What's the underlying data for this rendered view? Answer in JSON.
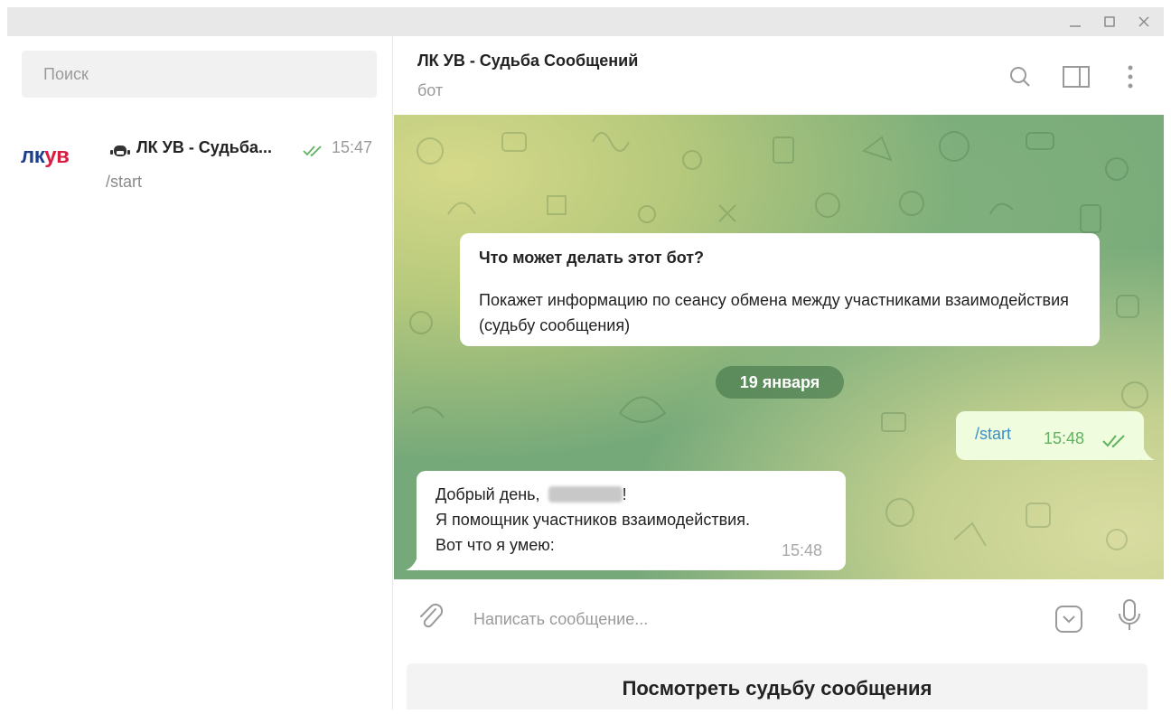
{
  "window": {
    "controls": [
      "minimize",
      "maximize",
      "close"
    ]
  },
  "sidebar": {
    "search_placeholder": "Поиск",
    "chats": [
      {
        "avatar_part1": "лк",
        "avatar_part2": "ув",
        "name": "ЛК УВ - Судьба...",
        "time": "15:47",
        "preview": "/start",
        "status": "read"
      }
    ]
  },
  "header": {
    "title": "ЛК УВ - Судьба Сообщений",
    "subtitle": "бот"
  },
  "messages": {
    "bot_info": {
      "question": "Что может делать этот бот?",
      "description": "Покажет информацию по сеансу обмена между участниками взаимодействия (судьбу сообщения)"
    },
    "date_separator": "19 января",
    "outgoing": {
      "text": "/start",
      "time": "15:48",
      "status": "read"
    },
    "incoming": {
      "line1_prefix": "Добрый день, ",
      "line1_suffix": "!",
      "line2": "Я помощник участников взаимодействия.",
      "line3": "Вот что я умею:",
      "time": "15:48"
    }
  },
  "composer": {
    "placeholder": "Написать сообщение..."
  },
  "bot_keyboard": {
    "button_label": "Посмотреть судьбу сообщения"
  },
  "colors": {
    "accent_link": "#3a8fcb",
    "read_check": "#5fb25f",
    "outgoing_bubble": "#effdde",
    "chat_background": "#76a97a",
    "logo_blue": "#1d3f8f",
    "logo_red": "#d81d3f"
  }
}
